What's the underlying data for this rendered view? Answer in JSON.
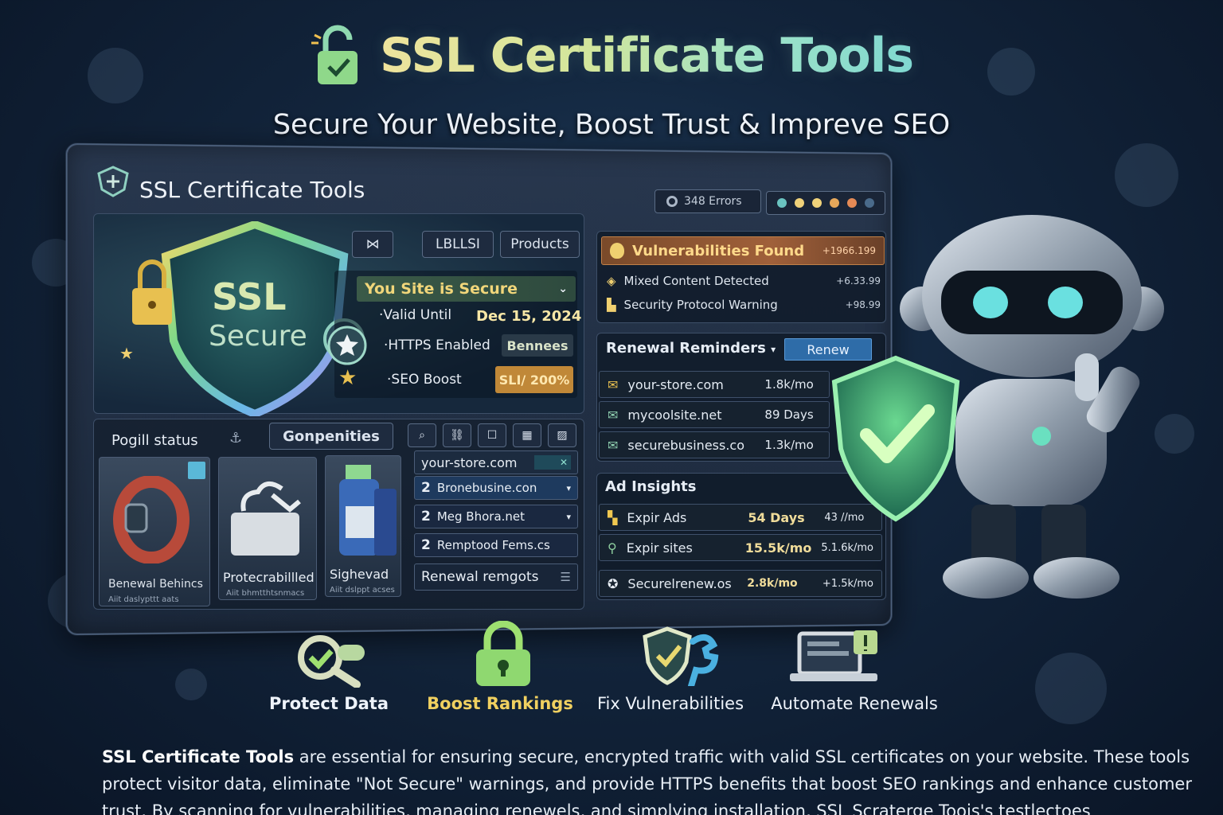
{
  "header": {
    "title": "SSL Certificate Tools",
    "subtitle": "Secure Your Website, Boost Trust & Impreve SEO"
  },
  "window": {
    "title": "SSL Certificate Tools",
    "errors_badge": "348 Errors",
    "status_dot_colors": [
      "#6ac3c0",
      "#f0d27a",
      "#f0d27a",
      "#e7a85a",
      "#e58a55",
      "#4a6a8a"
    ]
  },
  "shield": {
    "line1": "SSL",
    "line2": "Secure"
  },
  "tabs": {
    "icon_tab": "⋈",
    "tab1": "LBLLSI",
    "tab2": "Products"
  },
  "secure_card": {
    "heading": "You  Site is Secure",
    "rows": [
      {
        "label": "Valid Until",
        "value": "Dec 15, 2024"
      },
      {
        "label": "HTTPS Enabled",
        "value": "Bennees"
      },
      {
        "label": "SEO Boost",
        "value": "SLI/ 200%"
      }
    ]
  },
  "vulnerabilities": {
    "heading": "Vulnerabilities Found",
    "heading_value": "+1966.199",
    "items": [
      {
        "label": "Mixed Content Detected",
        "value": "+6.33.99"
      },
      {
        "label": "Security Protocol Warning",
        "value": "+98.99"
      }
    ]
  },
  "renewal": {
    "heading": "Renewal Reminders",
    "button": "Renew",
    "items": [
      {
        "domain": "your-store.com",
        "value": "1.8k/mo"
      },
      {
        "domain": "mycoolsite.net",
        "value": "89 Days"
      },
      {
        "domain": "securebusiness.co",
        "value": "1.3k/mo"
      }
    ]
  },
  "ad_insights": {
    "heading": "Ad Insights",
    "items": [
      {
        "label": "Expir Ads",
        "value1": "54 Days",
        "value2": "43 //mo"
      },
      {
        "label": "Expir sites",
        "value1": "15.5k/mo",
        "value2": "5.1.6k/mo"
      },
      {
        "label": "Securelrenew.os",
        "value1": "2.8k/mo",
        "value2": "+1.5k/mo"
      }
    ]
  },
  "status_section": {
    "label": "Pogill status",
    "tab": "Gonpenities",
    "cards": [
      {
        "title": "Benewal Behincs",
        "sub": "Aiit daslypttt aats"
      },
      {
        "title": "Protecrabillled",
        "sub": "Aiit bhmtthtsnmacs"
      },
      {
        "title": "Sighevad",
        "sub": "Aiit dslppt acses"
      }
    ]
  },
  "domains": {
    "search_value": "your-store.com",
    "rows": [
      {
        "prefix": "2",
        "name": "Bronebusine.con"
      },
      {
        "prefix": "2",
        "name": "Meg Bhora.net"
      },
      {
        "prefix": "2",
        "name": "Remptood Fems.cs"
      }
    ],
    "footer": "Renewal remgots"
  },
  "features": [
    {
      "label": "Protect Data",
      "icon": "magnifier-check-icon"
    },
    {
      "label": "Boost Rankings",
      "icon": "padlock-icon"
    },
    {
      "label": "Fix Vulnerabilities",
      "icon": "shield-wrench-icon"
    },
    {
      "label": "Automate Renewals",
      "icon": "laptop-alert-icon"
    }
  ],
  "description": {
    "bold": "SSL Certificate Tools",
    "text": " are essential for ensuring secure, encrypted traffic with valid SSL certificates on your website. These tools protect visitor data, eliminate \"Not Secure\" warnings, and provide HTTPS benefits that boost SEO rankings and enhance customer trust. By scanning for vulnerabilities, managing renewels, and simplying installation, SSL Scraterge Toois's testlectoes"
  }
}
